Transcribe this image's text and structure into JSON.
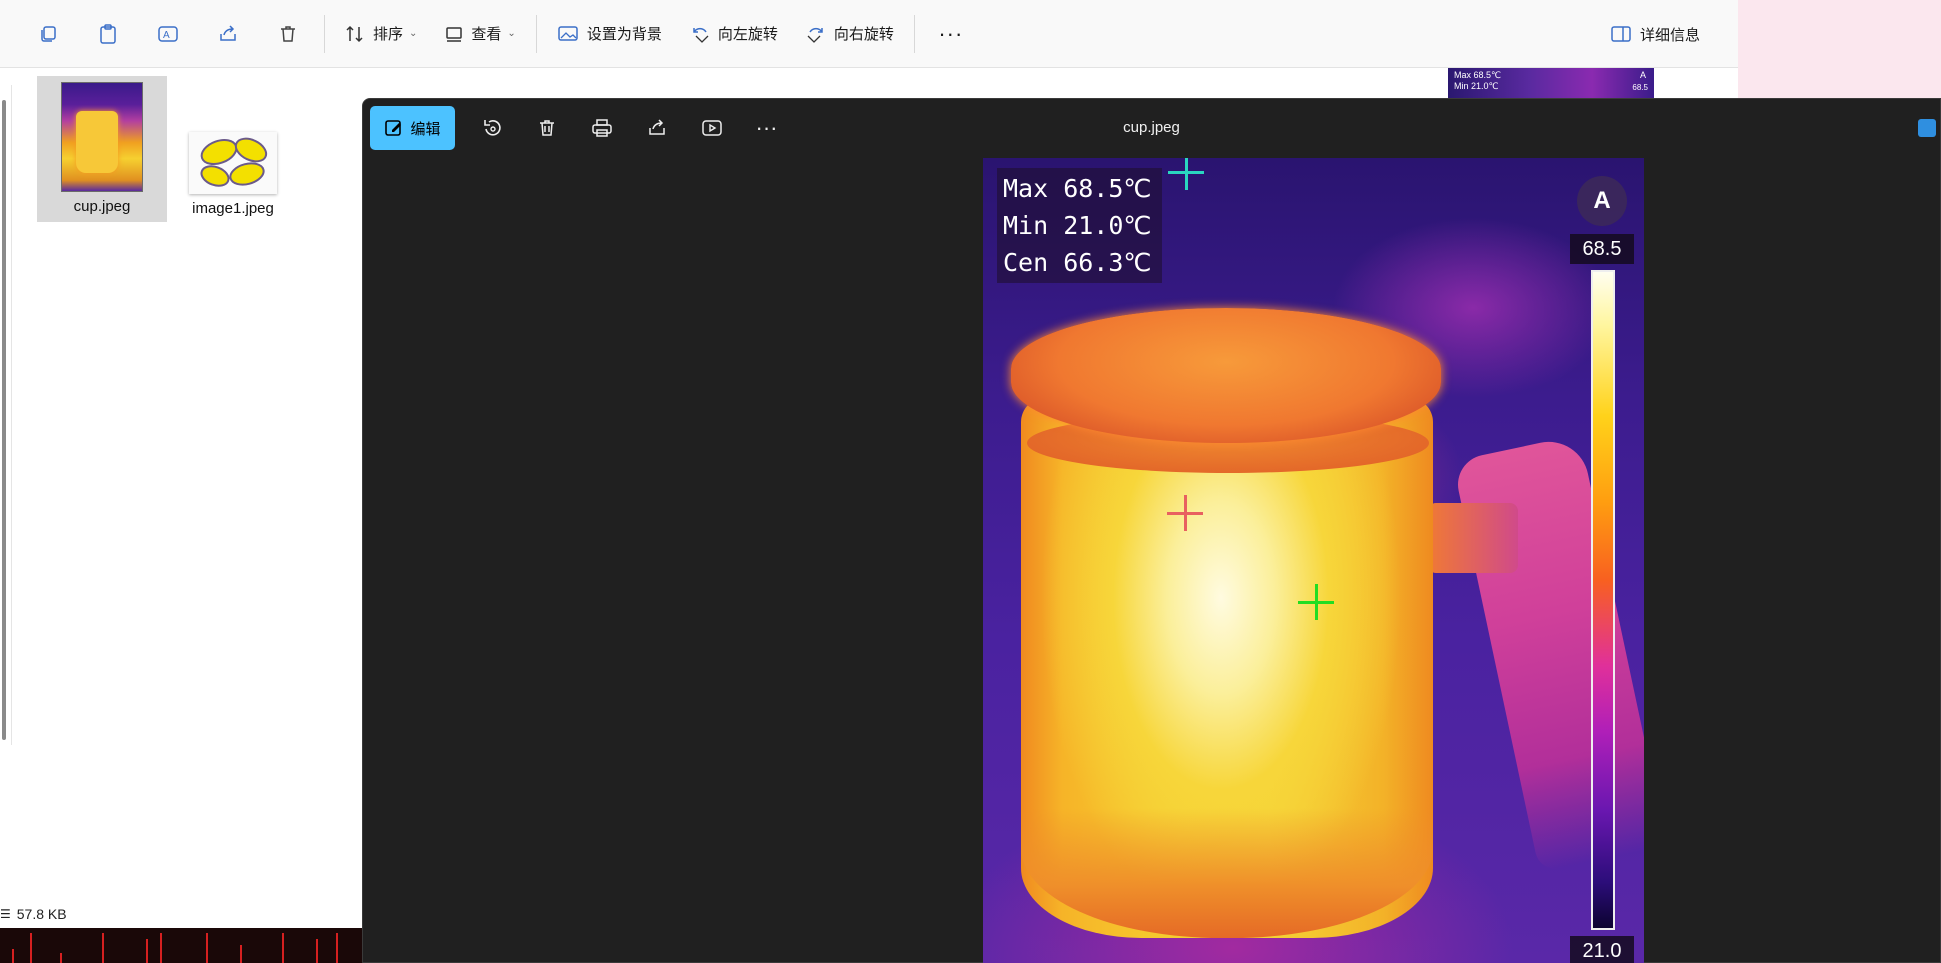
{
  "explorer": {
    "toolbar": {
      "sort_label": "排序",
      "view_label": "查看",
      "set_background_label": "设置为背景",
      "rotate_left_label": "向左旋转",
      "rotate_right_label": "向右旋转",
      "details_label": "详细信息"
    },
    "files": [
      {
        "name": "cup.jpeg",
        "selected": true
      },
      {
        "name": "image1.jpeg",
        "selected": false
      }
    ],
    "status": {
      "size": "57.8 KB"
    },
    "preview_thumb": {
      "line1": "Max 68.5℃",
      "line2": "Min 21.0℃",
      "badge": "A",
      "scale": "68.5"
    }
  },
  "viewer": {
    "title": "cup.jpeg",
    "edit_label": "编辑",
    "accent_color": "#4cc2ff",
    "thermal": {
      "max_line": "Max 68.5℃",
      "min_line": "Min 21.0℃",
      "cen_line": "Cen 66.3℃",
      "auto_badge": "A",
      "scale_max": "68.5",
      "scale_min": "21.0"
    }
  }
}
